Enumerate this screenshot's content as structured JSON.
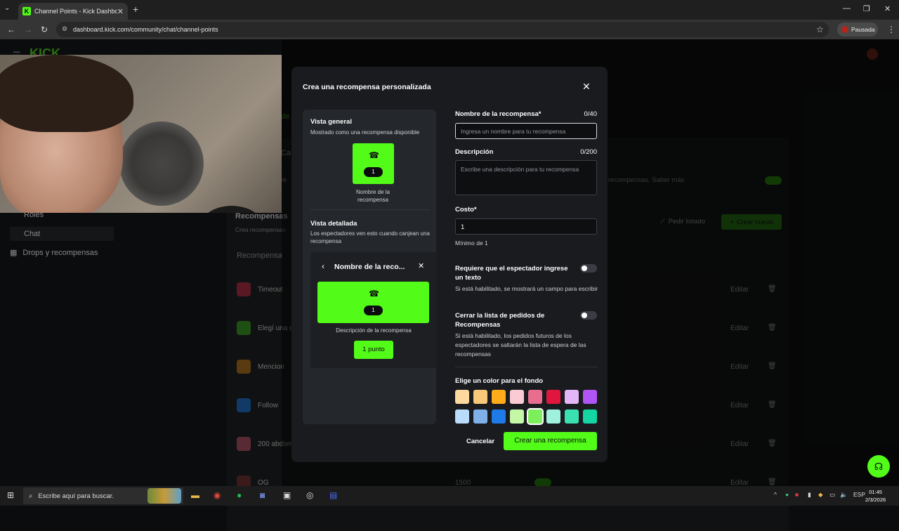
{
  "browser": {
    "tab_title": "Channel Points - Kick Dashboard",
    "tab_favicon": "K",
    "url": "dashboard.kick.com/community/chat/channel-points",
    "profile_label": "Pausada"
  },
  "dashboard": {
    "logo": "KICK",
    "sidebar": [
      {
        "label": "Roles"
      },
      {
        "label": "Chat"
      },
      {
        "label": "Drops y recompensas"
      }
    ],
    "section_title": "Recompensas",
    "section_subtitle": "Crea recompensas",
    "request_list_label": "Pedir listado",
    "create_new_label": "Crear nuevo",
    "info_text": "recompensas. Saber más",
    "column_header": "Recompensa",
    "rows": [
      {
        "name": "Timeout",
        "cost": ""
      },
      {
        "name": "Elegí una c",
        "cost": ""
      },
      {
        "name": "Mencion",
        "cost": ""
      },
      {
        "name": "Follow",
        "cost": ""
      },
      {
        "name": "200 abdom",
        "cost": ""
      },
      {
        "name": "OG",
        "cost": "1500"
      }
    ],
    "edit_label": "Editar"
  },
  "modal": {
    "title": "Crea una recompensa personalizada",
    "preview": {
      "overview_title": "Vista general",
      "overview_sub": "Mostrado como una recompensa disponible",
      "tile_cost": "1",
      "tile_name": "Nombre de la recompensa",
      "detail_title": "Vista detallada",
      "detail_sub": "Los espectadores ven esto cuando canjean una recompensa",
      "detail_card_title": "Nombre de la reco...",
      "detail_cost": "1",
      "detail_desc": "Descripción de la recompensa",
      "detail_button": "1 punto"
    },
    "form": {
      "name_label": "Nombre de la recompensa*",
      "name_count": "0/40",
      "name_placeholder": "Ingresa un nombre para tu recompensa",
      "desc_label": "Descripción",
      "desc_count": "0/200",
      "desc_placeholder": "Escribe una descripción para tu recompensa",
      "cost_label": "Costo*",
      "cost_value": "1",
      "cost_help": "Mínimo de 1",
      "require_text_label": "Requiere que el espectador ingrese un texto",
      "require_text_help": "Si está habilitado, se mostrará un campo para escribir",
      "skip_queue_label": "Cerrar la lista de pedidos de Recompensas",
      "skip_queue_help": "Si está habilitado, los pedidos futuros de los espectadores se saltarán la lista de espera de las recompensas",
      "color_label": "Elige un color para el fondo",
      "colors_row1": [
        "#fdd9a0",
        "#f8c77a",
        "#ffab1a",
        "#fbcbd5",
        "#e86d8f",
        "#e0163f",
        "#e2b6f7",
        "#b054f6"
      ],
      "colors_row2": [
        "#b9dcfb",
        "#7fb0ea",
        "#1e7ae6",
        "#c4f7a6",
        "#7eef5c",
        "#9ff0dc",
        "#3be0b0",
        "#14d6a3"
      ],
      "selected_color_index": 12
    },
    "cancel_label": "Cancelar",
    "submit_label": "Crear una recompensa"
  },
  "taskbar": {
    "search_placeholder": "Escribe aquí para buscar.",
    "language": "ESP",
    "time": "01:45",
    "date": "2/3/2026"
  },
  "colors": {
    "accent": "#53fc18",
    "modal_bg": "#191b1f",
    "panel_bg": "#24272c"
  }
}
